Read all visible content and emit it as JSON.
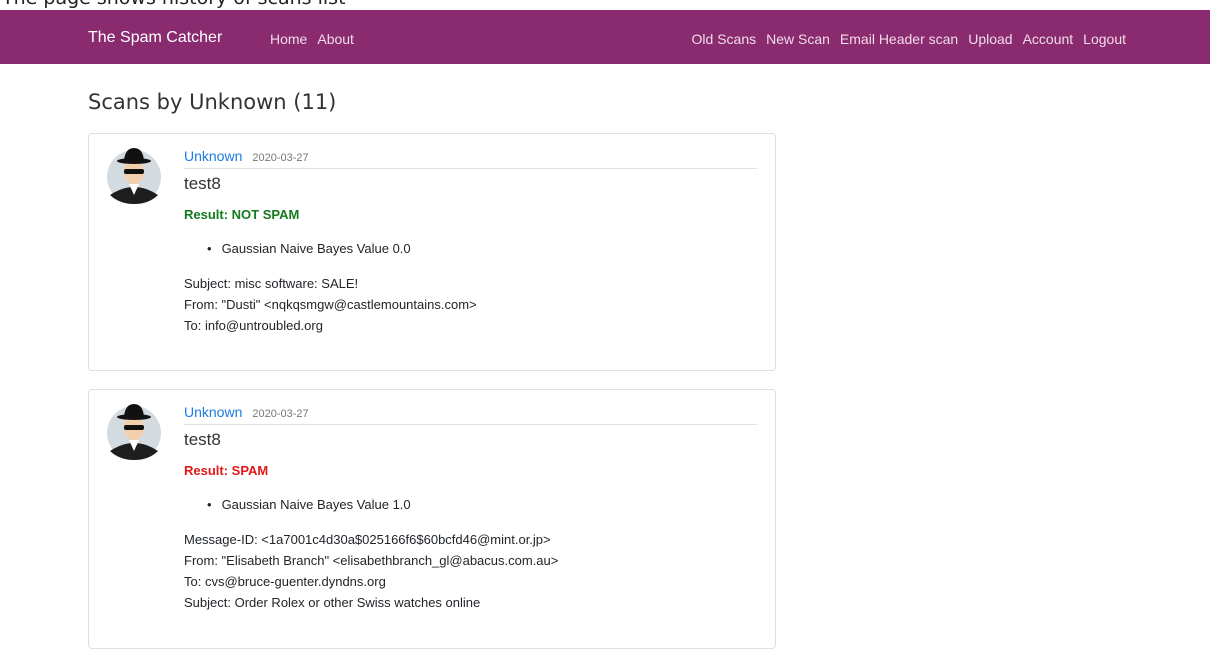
{
  "caption": "The page shows history of scans list",
  "navbar": {
    "brand": "The Spam Catcher",
    "left_links": [
      "Home",
      "About"
    ],
    "right_links": [
      "Old Scans",
      "New Scan",
      "Email Header scan",
      "Upload",
      "Account",
      "Logout"
    ],
    "color": "#8a2a6f"
  },
  "page": {
    "heading": "Scans by Unknown (11)"
  },
  "scans": [
    {
      "author": "Unknown",
      "date": "2020-03-27",
      "title": "test8",
      "result": "Result: NOT SPAM",
      "result_color": "#157a1e",
      "metrics": [
        "Gaussian Naive Bayes Value 0.0"
      ],
      "lines": [
        "Subject: misc software: SALE!",
        "From: \"Dusti\" <nqkqsmgw@castlemountains.com>",
        "To: info@untroubled.org"
      ]
    },
    {
      "author": "Unknown",
      "date": "2020-03-27",
      "title": "test8",
      "result": "Result: SPAM",
      "result_color": "#e01818",
      "metrics": [
        "Gaussian Naive Bayes Value 1.0"
      ],
      "lines": [
        "Message-ID: <1a7001c4d30a$025166f6$60bcfd46@mint.or.jp>",
        "From: \"Elisabeth Branch\" <elisabethbranch_gl@abacus.com.au>",
        "To: cvs@bruce-guenter.dyndns.org",
        "Subject: Order Rolex or other Swiss watches online"
      ]
    }
  ]
}
